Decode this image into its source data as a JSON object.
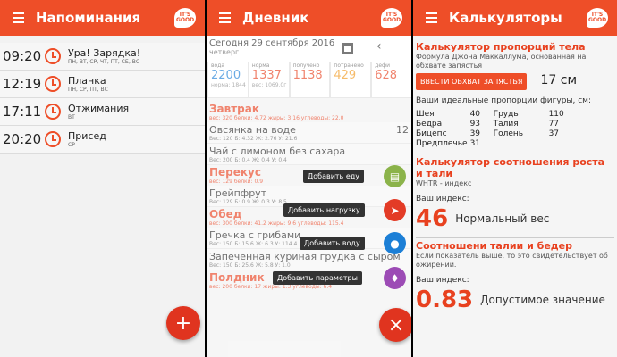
{
  "reminders": {
    "title": "Напоминания",
    "logo": "IT'S GOOD",
    "fab": "+",
    "items": [
      {
        "time": "09:20",
        "name": "Ура! Зарядка!",
        "days": "ПН, ВТ, СР, ЧТ, ПТ, СБ, ВС"
      },
      {
        "time": "12:19",
        "name": "Планка",
        "days": "ПН, СР, ПТ, ВС"
      },
      {
        "time": "17:11",
        "name": "Отжимания",
        "days": "ВТ"
      },
      {
        "time": "20:20",
        "name": "Присед",
        "days": "СР"
      }
    ]
  },
  "diary": {
    "title": "Дневник",
    "date": "Сегодня 29 сентября 2016",
    "weekday": "четверг",
    "stats": [
      {
        "label": "вода",
        "value": "2200",
        "sub": "норма: 1844",
        "color": "#1c7fd6"
      },
      {
        "label": "норма",
        "value": "1337",
        "sub": "вес: 1069.0г",
        "color": "#e8411f"
      },
      {
        "label": "получено",
        "value": "1138",
        "sub": "",
        "color": "#e8411f"
      },
      {
        "label": "потрачено",
        "value": "429",
        "sub": "",
        "color": "#f2981c"
      },
      {
        "label": "дефи",
        "value": "628",
        "sub": "",
        "color": "#e8411f"
      }
    ],
    "stat_units": [
      "г",
      "г",
      "г"
    ],
    "rows": [
      {
        "type": "meal",
        "name": "Завтрак",
        "sub": "вес: 320     белки: 4.72     жиры: 3.16     углеводы: 22.0"
      },
      {
        "type": "food",
        "name": "Овсянка на воде",
        "qty": "12",
        "sub": "Вес: 120     Б: 4.32     Ж: 2.76     У: 21.6"
      },
      {
        "type": "food",
        "name": "Чай с лимоном без сахара",
        "qty": "",
        "sub": "Вес: 200     Б: 0.4     Ж: 0.4     У: 0.4"
      },
      {
        "type": "meal",
        "name": "Перекус",
        "sub": "вес: 129     белки: 0.9"
      },
      {
        "type": "food",
        "name": "Грейпфрут",
        "qty": "",
        "sub": "Вес: 129     Б: 0.9     Ж: 0.3     У: 8.5"
      },
      {
        "type": "meal",
        "name": "Обед",
        "sub": "вес: 300     белки: 41.2     жиры: 9.6     углеводы: 115.4"
      },
      {
        "type": "food",
        "name": "Гречка с грибами",
        "qty": "",
        "sub": "Вес: 150     Б: 15.6     Ж: 6.3     У: 114.4"
      },
      {
        "type": "food",
        "name": "Запеченная куриная грудка с сыром",
        "qty": "",
        "sub": "Вес: 150     Б: 25.6     Ж: 5.8     У: 1.0"
      },
      {
        "type": "meal",
        "name": "Полдник",
        "sub": "вес: 200     белки: 17     жиры: 1.3     углеводы: 6.4"
      }
    ],
    "tooltips": [
      "Добавить еду",
      "Добавить нагрузку",
      "Добавить воду",
      "Добавить параметры"
    ],
    "fab": "×"
  },
  "calc": {
    "title": "Калькуляторы",
    "s1_title": "Калькулятор пропорций тела",
    "s1_desc": "Формула Джона Маккаллума, основанная на обхвате запястья",
    "s1_button": "ВВЕСТИ ОБХВАТ ЗАПЯСТЬЯ",
    "s1_value": "17 см",
    "s1_head": "Ваши идеальные пропорции фигуры, см:",
    "proportions": [
      [
        "Шея",
        "40",
        "Грудь",
        "110"
      ],
      [
        "Бёдра",
        "93",
        "Талия",
        "77"
      ],
      [
        "Бицепс",
        "39",
        "Голень",
        "37"
      ],
      [
        "Предплечье",
        "31",
        "",
        ""
      ]
    ],
    "s2_title": "Калькулятор соотношения роста и тали",
    "s2_desc": "WHTR - индекс",
    "s2_head": "Ваш индекс:",
    "s2_value": "46",
    "s2_label": "Нормальный вес",
    "s3_title": "Соотношени талии и бедер",
    "s3_desc": "Если показатель выше, то это свидетельствует об ожирении.",
    "s3_head": "Ваш индекс:",
    "s3_value": "0.83",
    "s3_label": "Допустимое значение"
  }
}
